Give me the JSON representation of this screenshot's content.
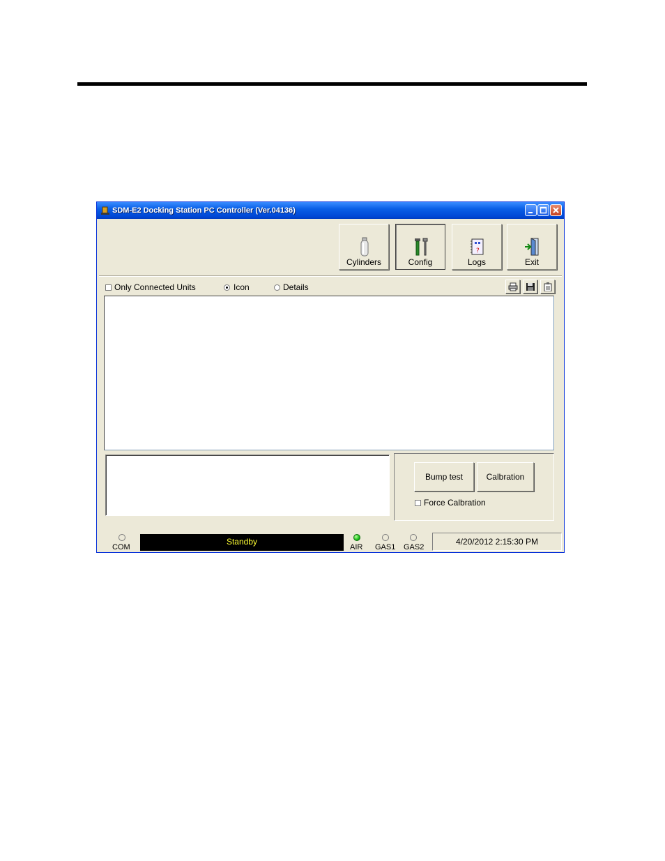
{
  "window": {
    "title": "SDM-E2 Docking Station PC Controller (Ver.04136)"
  },
  "toolbar": {
    "buttons": [
      {
        "label": "Cylinders",
        "icon": "cylinder-icon"
      },
      {
        "label": "Config",
        "icon": "tools-icon"
      },
      {
        "label": "Logs",
        "icon": "logbook-icon"
      },
      {
        "label": "Exit",
        "icon": "exit-door-icon"
      }
    ]
  },
  "options": {
    "only_connected_label": "Only Connected Units",
    "only_connected_checked": false,
    "view_mode": {
      "icon_label": "Icon",
      "details_label": "Details",
      "selected": "Icon"
    }
  },
  "actions": {
    "bump_label": "Bump test",
    "calibration_label": "Calbration",
    "force_cal_label": "Force Calbration",
    "force_cal_checked": false
  },
  "status": {
    "com_label": "COM",
    "message": "Standby",
    "air_label": "AIR",
    "air_on": true,
    "gas1_label": "GAS1",
    "gas2_label": "GAS2",
    "datetime": "4/20/2012 2:15:30 PM"
  },
  "colors": {
    "titlebar": "#0054e3",
    "window_bg": "#ece9d8",
    "status_text": "#ffff33",
    "led_on": "#18c018"
  }
}
